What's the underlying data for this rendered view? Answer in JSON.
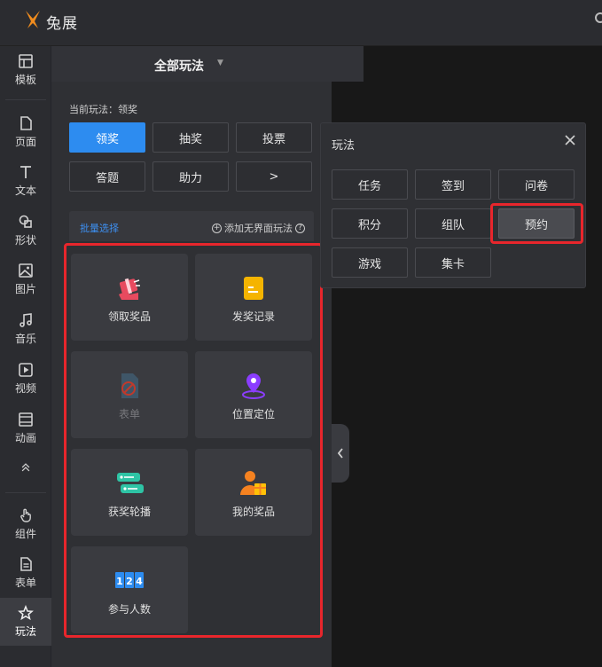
{
  "app": {
    "name": "兔展"
  },
  "nav": {
    "items": [
      {
        "label": "模板",
        "icon": "template-icon"
      },
      {
        "label": "页面",
        "icon": "page-icon"
      },
      {
        "label": "文本",
        "icon": "text-icon"
      },
      {
        "label": "形状",
        "icon": "shape-icon"
      },
      {
        "label": "图片",
        "icon": "image-icon"
      },
      {
        "label": "音乐",
        "icon": "music-icon"
      },
      {
        "label": "视频",
        "icon": "video-icon"
      },
      {
        "label": "动画",
        "icon": "animation-icon"
      },
      {
        "label": "组件",
        "icon": "component-icon"
      },
      {
        "label": "表单",
        "icon": "form-icon"
      },
      {
        "label": "玩法",
        "icon": "play-icon"
      }
    ]
  },
  "panel": {
    "title": "全部玩法",
    "current_play": "当前玩法：领奖",
    "categories": [
      "领奖",
      "抽奖",
      "投票",
      "答题",
      "助力",
      ">"
    ],
    "batch_select": "批量选择",
    "add_play": "添加无界面玩法",
    "cards": [
      "领取奖品",
      "发奖记录",
      "表单",
      "位置定位",
      "获奖轮播",
      "我的奖品",
      "参与人数"
    ]
  },
  "popup": {
    "title": "玩法",
    "options": [
      "任务",
      "签到",
      "问卷",
      "积分",
      "组队",
      "预约",
      "游戏",
      "集卡"
    ],
    "selected": "预约"
  },
  "colors": {
    "accent": "#2d8cf0",
    "highlight": "#e8262c"
  }
}
